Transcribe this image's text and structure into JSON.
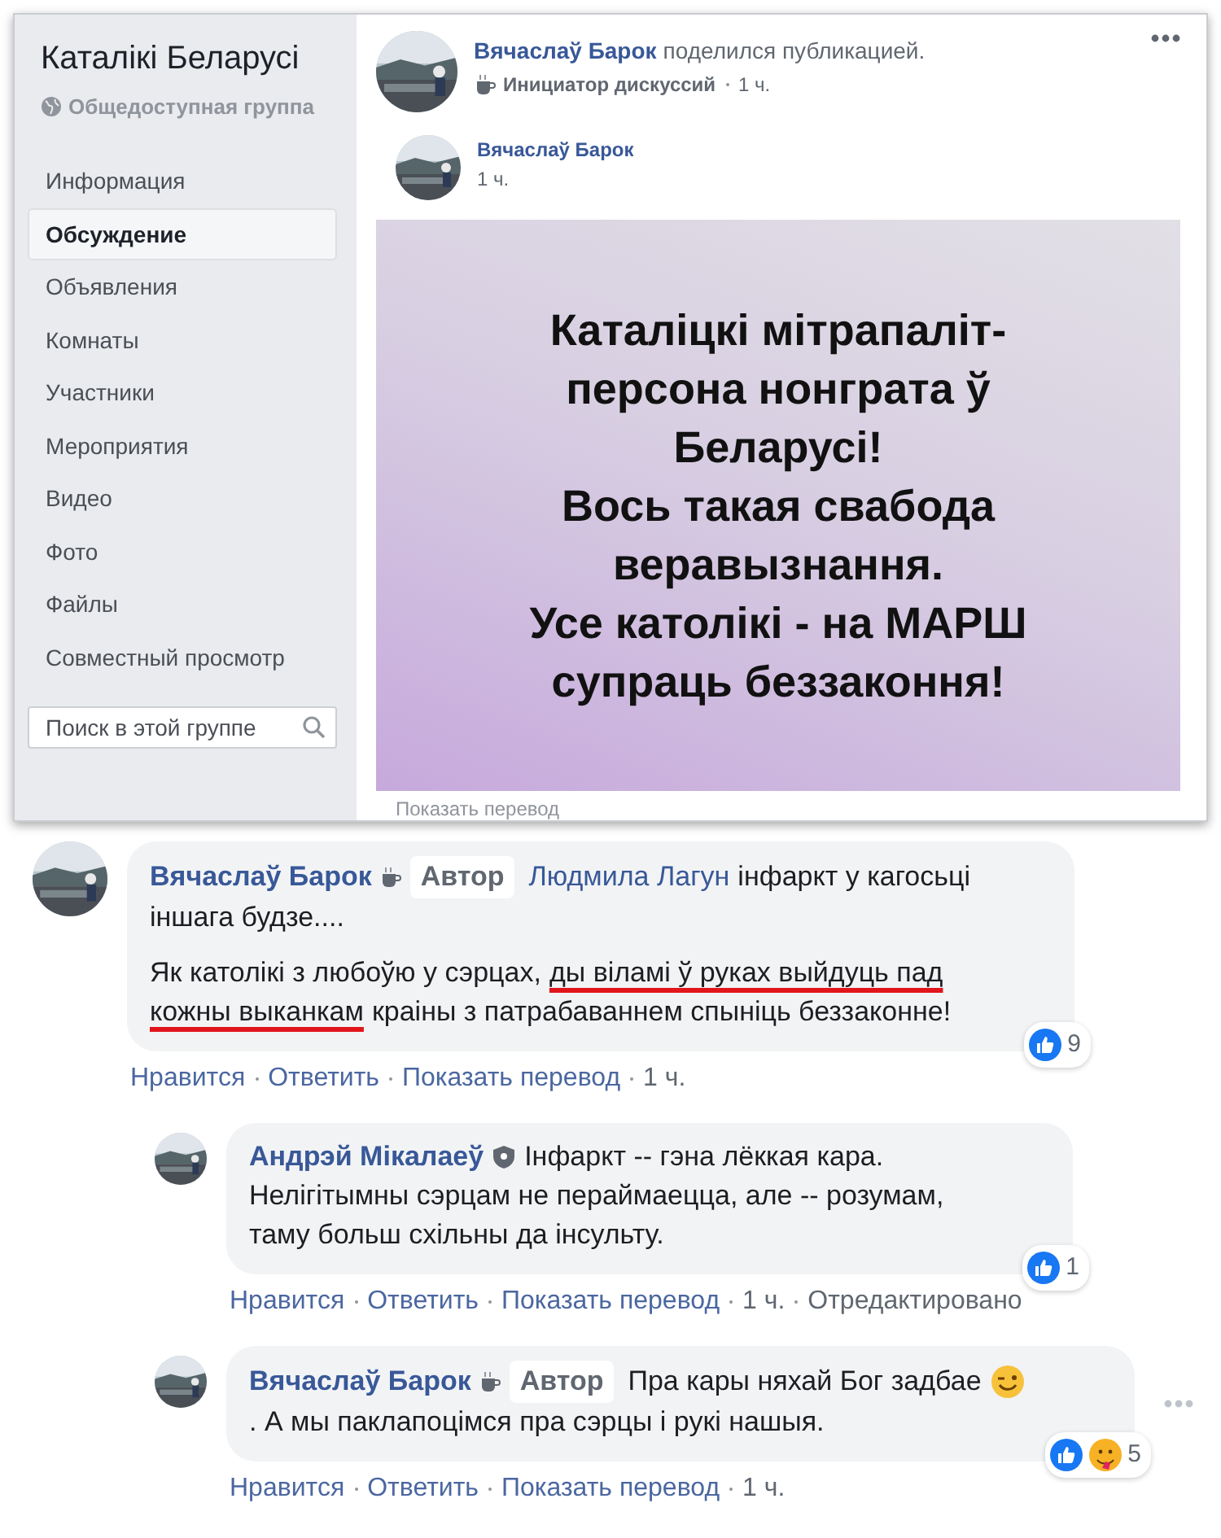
{
  "group": {
    "title": "Каталікі Беларусі",
    "privacy": "Общедоступная группа"
  },
  "sidebar": {
    "items": [
      {
        "label": "Информация",
        "selected": false
      },
      {
        "label": "Обсуждение",
        "selected": true
      },
      {
        "label": "Объявления",
        "selected": false
      },
      {
        "label": "Комнаты",
        "selected": false
      },
      {
        "label": "Участники",
        "selected": false
      },
      {
        "label": "Мероприятия",
        "selected": false
      },
      {
        "label": "Видео",
        "selected": false
      },
      {
        "label": "Фото",
        "selected": false
      },
      {
        "label": "Файлы",
        "selected": false
      },
      {
        "label": "Совместный просмотр",
        "selected": false
      }
    ],
    "search": {
      "placeholder": "Поиск в этой группе"
    }
  },
  "post": {
    "author": "Вячаслаў Барок",
    "action": "поделился публикацией.",
    "role": "Инициатор дискуссий",
    "time": "1 ч.",
    "shared": {
      "author": "Вячаслаў Барок",
      "time": "1 ч.",
      "image_lines": [
        "Каталіцкі мітрапаліт-",
        "персона нонграта ў",
        "Беларусі!",
        "Вось такая свабода",
        "веравызнання.",
        "Усе католікі - на МАРШ",
        "супраць беззаконня!"
      ]
    },
    "translate": "Показать перевод"
  },
  "comments": [
    {
      "author": "Вячаслаў Барок",
      "author_icon": {
        "kind": "cup"
      },
      "badge": "Автор",
      "more": false,
      "paragraphs": [
        [
          [
            {
              "kind": "mention",
              "text": "Людмила Лагун"
            },
            {
              "kind": "text",
              "text": "інфаркт у кагосьці"
            }
          ],
          [
            {
              "kind": "text",
              "text": "іншага будзе...."
            }
          ]
        ],
        [
          [
            {
              "kind": "text",
              "text": "Як католікі з любоўю у сэрцах,"
            },
            {
              "kind": "marked",
              "text": "ды віламі ў руках выйдуць пад"
            }
          ],
          [
            {
              "kind": "marked",
              "text": "кожны выканкам"
            },
            {
              "kind": "text",
              "text": "краіны з патрабаваннем спыніць беззаконне!"
            }
          ]
        ]
      ],
      "reactions": [
        {
          "kind": "like"
        }
      ],
      "count": "9",
      "actions": [
        "Нравится",
        "Ответить",
        "Показать перевод",
        "1 ч."
      ],
      "children": [
        {
          "author": "Андрэй Мікалаеў",
          "author_icon": {
            "kind": "shield"
          },
          "more": false,
          "paragraphs": [
            [
              [
                {
                  "kind": "text",
                  "text": "Інфаркт -- гэна лёккая кара."
                }
              ],
              [
                {
                  "kind": "text",
                  "text": "Нелігітымны сэрцам не пераймаецца, але -- розумам,"
                }
              ],
              [
                {
                  "kind": "text",
                  "text": "таму больш схільны да інсульту."
                }
              ]
            ]
          ],
          "reactions": [
            {
              "kind": "like"
            }
          ],
          "count": "1",
          "actions": [
            "Нравится",
            "Ответить",
            "Показать перевод",
            "1 ч.",
            "Отредактировано"
          ]
        },
        {
          "author": "Вячаслаў Барок",
          "author_icon": {
            "kind": "cup"
          },
          "badge": "Автор",
          "more": true,
          "paragraphs": [
            [
              [
                {
                  "kind": "text",
                  "text": "Пра кары няхай Бог задбае"
                },
                {
                  "kind": "emoji"
                }
              ],
              [
                {
                  "kind": "text",
                  "text": ". А мы паклапоцімся пра сэрцы і рукі нашыя."
                }
              ]
            ]
          ],
          "reactions": [
            {
              "kind": "like"
            },
            {
              "kind": "care"
            }
          ],
          "count": "5",
          "actions": [
            "Нравится",
            "Ответить",
            "Показать перевод",
            "1 ч."
          ]
        }
      ]
    }
  ]
}
